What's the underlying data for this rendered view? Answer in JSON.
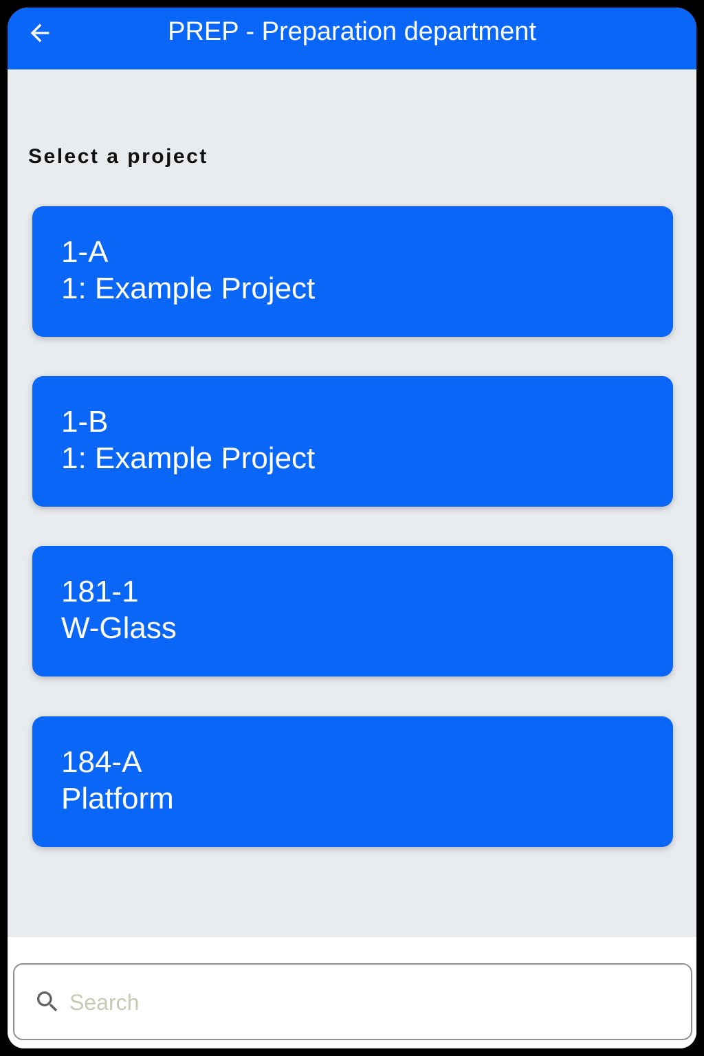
{
  "header": {
    "title": "PREP - Preparation department",
    "back_icon": "arrow-left-icon"
  },
  "main": {
    "section_label": "Select a project",
    "projects": [
      {
        "code": "1-A",
        "name": "1: Example Project"
      },
      {
        "code": "1-B",
        "name": "1: Example Project"
      },
      {
        "code": "181-1",
        "name": "W-Glass"
      },
      {
        "code": "184-A",
        "name": "Platform"
      }
    ]
  },
  "search": {
    "placeholder": "Search",
    "value": "",
    "icon": "search-icon"
  },
  "colors": {
    "accent": "#0a66f6",
    "background": "#e9ecef",
    "text_on_accent": "#ffffff"
  }
}
